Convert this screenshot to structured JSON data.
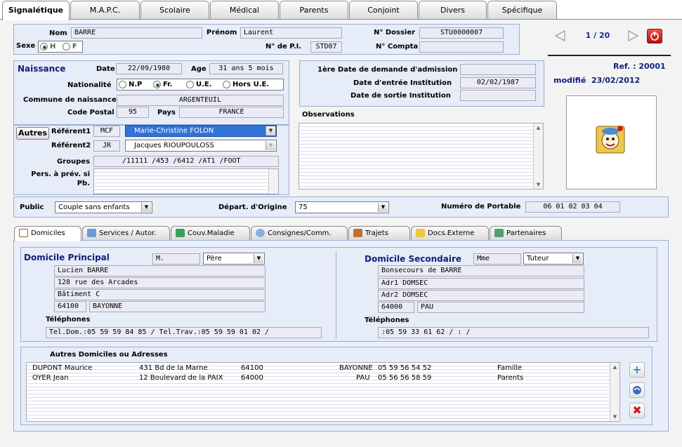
{
  "top_tabs": [
    "Signalétique",
    "M.A.P.C.",
    "Scolaire",
    "Médical",
    "Parents",
    "Conjoint",
    "Divers",
    "Spécifique"
  ],
  "identity": {
    "nom_label": "Nom",
    "nom": "BARRE",
    "prenom_label": "Prénom",
    "prenom": "Laurent",
    "sexe_label": "Sexe",
    "sexe_h": "H",
    "sexe_f": "F",
    "dossier_label": "N° Dossier",
    "dossier": "STU0000007",
    "pi_label": "N° de P.I.",
    "pi": "STD07",
    "compta_label": "N° Compta",
    "compta": ""
  },
  "nav": {
    "counter": "1 / 20"
  },
  "birth": {
    "title": "Naissance",
    "date_label": "Date",
    "date": "22/09/1980",
    "age_label": "Age",
    "age": "31 ans  5 mois",
    "nat_label": "Nationalité",
    "nat_np": "N.P",
    "nat_fr": "Fr.",
    "nat_ue": "U.E.",
    "nat_hors": "Hors U.E.",
    "commune_label": "Commune de naissance",
    "commune": "ARGENTEUIL",
    "cp_label": "Code Postal",
    "cp": "95",
    "pays_label": "Pays",
    "pays": "FRANCE"
  },
  "institution": {
    "demande_label": "1ère Date de demande d'admission",
    "demande": "",
    "entree_label": "Date d'entrée Institution",
    "entree": "02/02/1987",
    "sortie_label": "Date de sortie Institution",
    "sortie": "",
    "obs_label": "Observations"
  },
  "ref": {
    "ref_label": "Ref. :",
    "ref": "20001",
    "modif_label": "modifié",
    "modif": "23/02/2012"
  },
  "referents": {
    "autres_button": "Autres",
    "ref1_label": "Référent1",
    "ref1_code": "MCF",
    "ref1_name": "Marie-Christine FOLON",
    "ref2_label": "Référent2",
    "ref2_code": "JR",
    "ref2_name": "Jacques RIOUPOULOSS",
    "groupes_label": "Groupes",
    "groupes": "/11111 /453  /6412 /AT1  /FOOT",
    "pers_label": "Pers. à prév. si Pb."
  },
  "public": {
    "public_label": "Public",
    "public": "Couple sans enfants",
    "depart_label": "Départ. d'Origine",
    "depart": "75",
    "portable_label": "Numéro de Portable",
    "portable": "06 01 02 03 04"
  },
  "bottom_tabs": [
    "Domiciles",
    "Services / Autor.",
    "Couv.Maladie",
    "Consignes/Comm.",
    "Trajets",
    "Docs.Externe",
    "Partenaires"
  ],
  "domicile_principal": {
    "title": "Domicile Principal",
    "civ": "M.",
    "lien": "Père",
    "name": "Lucien BARRE",
    "addr1": "128 rue des Arcades",
    "addr2": "Bâtiment C",
    "cp": "64100",
    "ville": "BAYONNE",
    "tel_label": "Téléphones",
    "tel": "Tel.Dom.:05 59 59 84 85 / Tel.Trav.:05 59 59 01 02 /"
  },
  "domicile_secondaire": {
    "title": "Domicile Secondaire",
    "civ": "Mme",
    "lien": "Tuteur",
    "name": "Bonsecours de BARRE",
    "addr1": "Adr1 DOMSEC",
    "addr2": "Adr2 DOMSEC",
    "cp": "64000",
    "ville": "PAU",
    "tel_label": "Téléphones",
    "tel": ":05 59 33 61 62 / : /"
  },
  "autres": {
    "title": "Autres Domiciles ou Adresses",
    "rows": [
      {
        "name": "DUPONT Maurice",
        "addr": "431 Bd de la Marne",
        "cp": "64100",
        "ville": "BAYONNE",
        "tel": "05 59 56 54 52",
        "type": "Famille"
      },
      {
        "name": "OYER Jean",
        "addr": "12 Boulevard de la PAIX",
        "cp": "64000",
        "ville": "PAU",
        "tel": "05 56 56 58 59",
        "type": "Parents"
      }
    ]
  }
}
